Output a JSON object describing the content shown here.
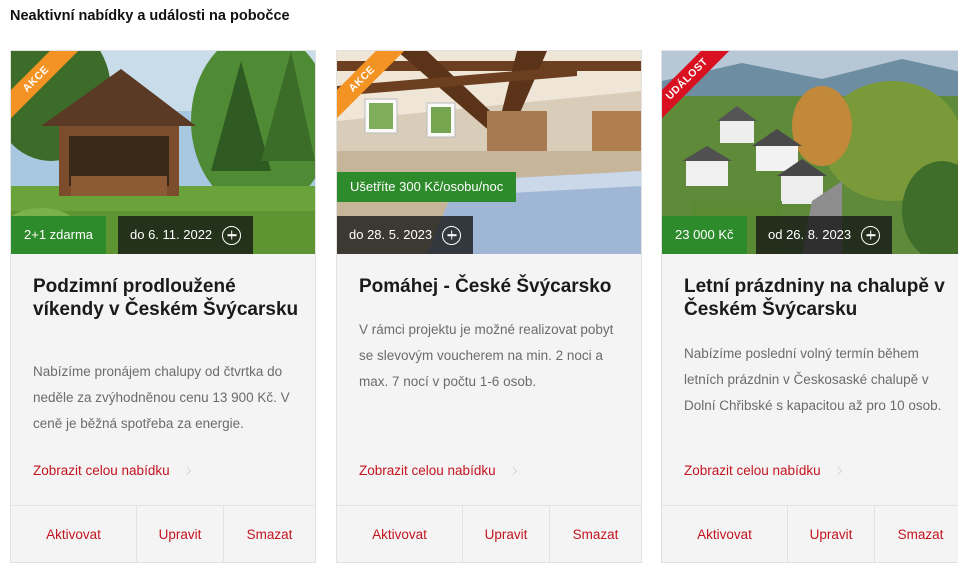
{
  "section_title": "Neaktivní nabídky a události na pobočce",
  "colors": {
    "accent_red": "#c4141f",
    "promo_orange": "#f39323",
    "event_red": "#d8101f",
    "tag_green": "#2e8b2b"
  },
  "cards": [
    {
      "ribbon": "AKCE",
      "green_tag": "2+1 zdarma",
      "date_tag": "do 6. 11. 2022",
      "title": "Podzimní prodloužené víkendy v Českém Švýcarsku",
      "description": "Nabízíme pronájem chalupy od čtvrtka do neděle za zvýhodněnou cenu 13 900 Kč. V ceně je běžná spotřeba za energie.",
      "link": "Zobrazit celou nabídku",
      "actions": [
        "Aktivovat",
        "Upravit",
        "Smazat"
      ]
    },
    {
      "ribbon": "AKCE",
      "green_tag": "Ušetříte 300 Kč/osobu/noc",
      "date_tag": "do 28. 5. 2023",
      "title": "Pomáhej - České Švýcarsko",
      "description": "V rámci projektu je možné realizovat pobyt se slevovým voucherem na min. 2 noci a max. 7 nocí v počtu 1-6 osob.",
      "link": "Zobrazit celou nabídku",
      "actions": [
        "Aktivovat",
        "Upravit",
        "Smazat"
      ]
    },
    {
      "ribbon": "UDÁLOST",
      "green_tag": "23 000 Kč",
      "date_tag": "od 26. 8. 2023",
      "title": "Letní prázdniny na chalupě v Českém Švýcarsku",
      "description": "Nabízíme poslední volný termín během letních prázdnin v Českosaské chalupě v Dolní Chřibské s kapacitou až pro 10 osob.",
      "link": "Zobrazit celou nabídku",
      "actions": [
        "Aktivovat",
        "Upravit",
        "Smazat"
      ]
    }
  ]
}
